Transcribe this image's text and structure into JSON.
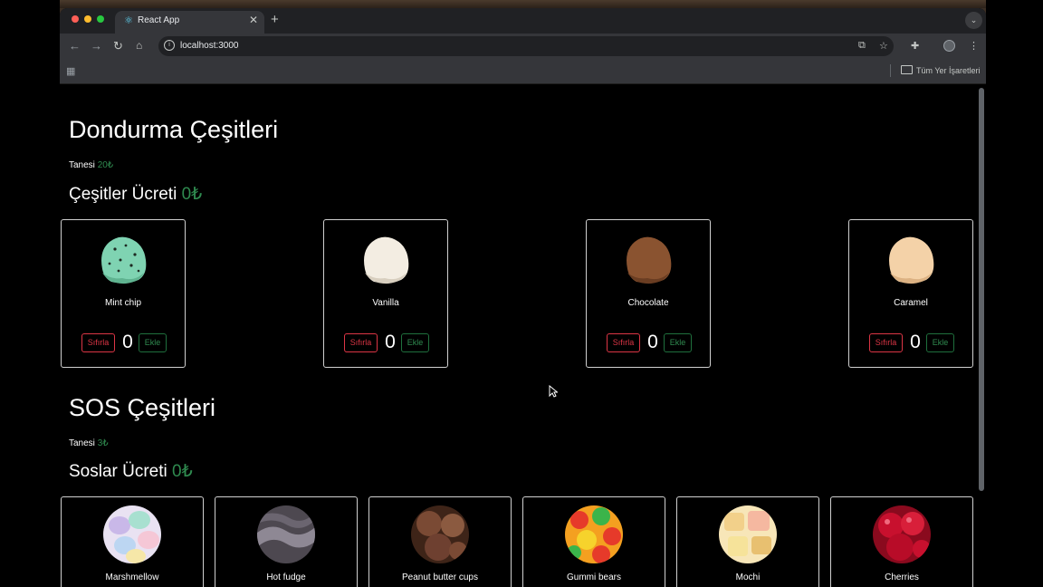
{
  "browser": {
    "tab_title": "React App",
    "url": "localhost:3000",
    "bookmarks_folder": "Tüm Yer İşaretleri"
  },
  "icecream": {
    "title": "Dondurma Çeşitleri",
    "unit_price_label": "Tanesi",
    "unit_price_value": "20₺",
    "total_label": "Çeşitler Ücreti",
    "total_value": "0₺",
    "items": [
      {
        "name": "Mint chip",
        "count": "0",
        "color": "#7fd3b2"
      },
      {
        "name": "Vanilla",
        "count": "0",
        "color": "#f3ede2"
      },
      {
        "name": "Chocolate",
        "count": "0",
        "color": "#8a5330"
      },
      {
        "name": "Caramel",
        "count": "0",
        "color": "#f4d2a8"
      }
    ],
    "reset_label": "Sıfırla",
    "add_label": "Ekle"
  },
  "sauces": {
    "title": "SOS Çeşitleri",
    "unit_price_label": "Tanesi",
    "unit_price_value": "3₺",
    "total_label": "Soslar Ücreti",
    "total_value": "0₺",
    "items": [
      {
        "name": "Marshmellow",
        "color": "#c9b8e8"
      },
      {
        "name": "Hot fudge",
        "color": "#6b6570"
      },
      {
        "name": "Peanut butter cups",
        "color": "#7a4a34"
      },
      {
        "name": "Gummi bears",
        "color": "#e63a2a"
      },
      {
        "name": "Mochi",
        "color": "#f2d08a"
      },
      {
        "name": "Cherries",
        "color": "#c8102e"
      }
    ]
  }
}
